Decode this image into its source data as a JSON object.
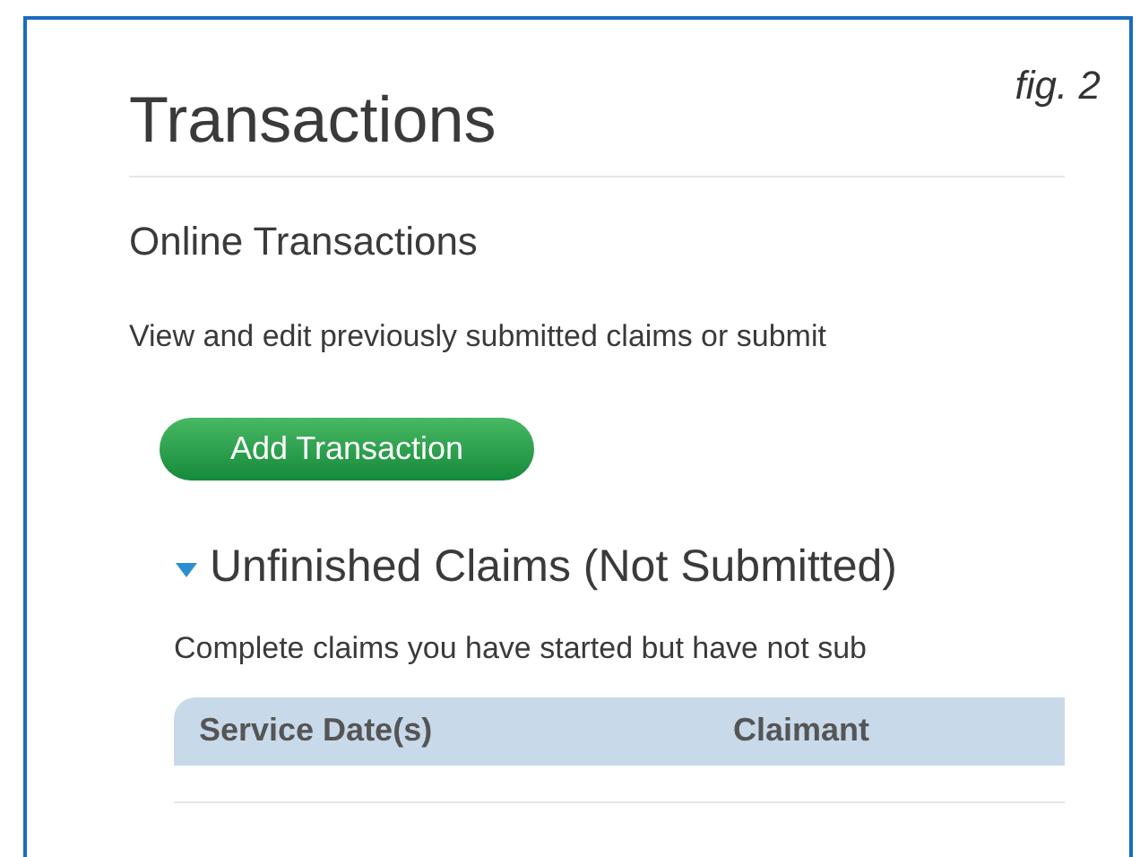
{
  "figure_label": "fig. 2",
  "page": {
    "title": "Transactions",
    "subtitle": "Online Transactions",
    "description": "View and edit previously submitted claims or submit",
    "add_button": "Add Transaction"
  },
  "section": {
    "title": "Unfinished Claims (Not Submitted)",
    "expanded": true,
    "description": "Complete claims you have started but have not sub",
    "table": {
      "columns": [
        "Service Date(s)",
        "Claimant"
      ]
    }
  }
}
